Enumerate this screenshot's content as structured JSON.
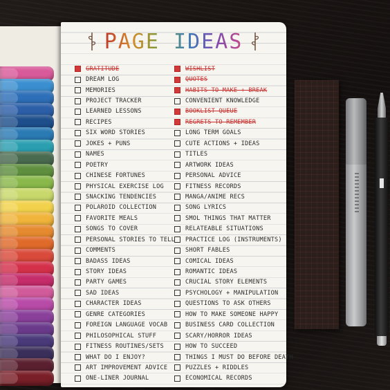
{
  "title": "PAGE IDEAS",
  "marker_colors": [
    "#d95a9a",
    "#3a8fd0",
    "#2d6fb8",
    "#2c5fa8",
    "#1e4f8c",
    "#2a7ab4",
    "#2a9fb0",
    "#4a6b50",
    "#5f8f3e",
    "#8ab84a",
    "#c9d86a",
    "#f2d24a",
    "#f0b43a",
    "#e58a2e",
    "#e06a2a",
    "#d94a3a",
    "#d4304a",
    "#c42c6a",
    "#d05a9a",
    "#b84aa8",
    "#8a3f9a",
    "#6a3a8a",
    "#4a3a7a",
    "#3a2f5a",
    "#5a2030",
    "#7a1f28"
  ],
  "left_column": [
    {
      "text": "GRATITUDE",
      "done": true
    },
    {
      "text": "DREAM LOG",
      "done": false
    },
    {
      "text": "MEMORIES",
      "done": false
    },
    {
      "text": "PROJECT TRACKER",
      "done": false
    },
    {
      "text": "LEARNED LESSONS",
      "done": false
    },
    {
      "text": "RECIPES",
      "done": false
    },
    {
      "text": "SIX WORD STORIES",
      "done": false
    },
    {
      "text": "JOKES + PUNS",
      "done": false
    },
    {
      "text": "NAMES",
      "done": false
    },
    {
      "text": "POETRY",
      "done": false
    },
    {
      "text": "CHINESE FORTUNES",
      "done": false
    },
    {
      "text": "PHYSICAL EXERCISE LOG",
      "done": false
    },
    {
      "text": "SNACKING TENDENCIES",
      "done": false
    },
    {
      "text": "POLAROID COLLECTION",
      "done": false
    },
    {
      "text": "FAVORITE MEALS",
      "done": false
    },
    {
      "text": "SONGS TO COVER",
      "done": false
    },
    {
      "text": "PERSONAL STORIES TO TELL",
      "done": false
    },
    {
      "text": "COMMENTS",
      "done": false
    },
    {
      "text": "BADASS IDEAS",
      "done": false
    },
    {
      "text": "STORY IDEAS",
      "done": false
    },
    {
      "text": "PARTY GAMES",
      "done": false
    },
    {
      "text": "SAD IDEAS",
      "done": false
    },
    {
      "text": "CHARACTER IDEAS",
      "done": false
    },
    {
      "text": "GENRE CATEGORIES",
      "done": false
    },
    {
      "text": "FOREIGN LANGUAGE VOCAB",
      "done": false
    },
    {
      "text": "PHILOSOPHICAL STUFF",
      "done": false
    },
    {
      "text": "FITNESS ROUTINES/SETS",
      "done": false
    },
    {
      "text": "WHAT DO I ENJOY?",
      "done": false
    },
    {
      "text": "ART IMPROVEMENT ADVICE",
      "done": false
    },
    {
      "text": "ONE-LINER JOURNAL",
      "done": false
    }
  ],
  "right_column": [
    {
      "text": "WISHLIST",
      "done": true
    },
    {
      "text": "QUOTES",
      "done": true
    },
    {
      "text": "HABITS TO MAKE + BREAK",
      "done": true
    },
    {
      "text": "CONVENIENT KNOWLEDGE",
      "done": false
    },
    {
      "text": "BOOKLIST QUEUE",
      "done": true
    },
    {
      "text": "REGRETS TO REMEMBER",
      "done": true
    },
    {
      "text": "LONG TERM GOALS",
      "done": false
    },
    {
      "text": "CUTE ACTIONS + IDEAS",
      "done": false
    },
    {
      "text": "TITLES",
      "done": false
    },
    {
      "text": "ARTWORK IDEAS",
      "done": false
    },
    {
      "text": "PERSONAL ADVICE",
      "done": false
    },
    {
      "text": "FITNESS RECORDS",
      "done": false
    },
    {
      "text": "MANGA/ANIME RECS",
      "done": false
    },
    {
      "text": "SONG LYRICS",
      "done": false
    },
    {
      "text": "SMOL THINGS THAT MATTER",
      "done": false
    },
    {
      "text": "RELATEABLE SITUATIONS",
      "done": false
    },
    {
      "text": "PRACTICE LOG (INSTRUMENTS)",
      "done": false
    },
    {
      "text": "SHORT FABLES",
      "done": false
    },
    {
      "text": "COMICAL IDEAS",
      "done": false
    },
    {
      "text": "ROMANTIC IDEAS",
      "done": false
    },
    {
      "text": "CRUCIAL STORY ELEMENTS",
      "done": false
    },
    {
      "text": "PSYCHOLOGY + MANIPULATION",
      "done": false
    },
    {
      "text": "QUESTIONS TO ASK OTHERS",
      "done": false
    },
    {
      "text": "HOW TO MAKE SOMEONE HAPPY",
      "done": false
    },
    {
      "text": "BUSINESS CARD COLLECTION",
      "done": false
    },
    {
      "text": "SCARY/HORROR IDEAS",
      "done": false
    },
    {
      "text": "HOW TO SUCCEED",
      "done": false
    },
    {
      "text": "THINGS I MUST DO BEFORE DEATH",
      "done": false
    },
    {
      "text": "PUZZLES + RIDDLES",
      "done": false
    },
    {
      "text": "ECONOMICAL RECORDS",
      "done": false
    }
  ]
}
